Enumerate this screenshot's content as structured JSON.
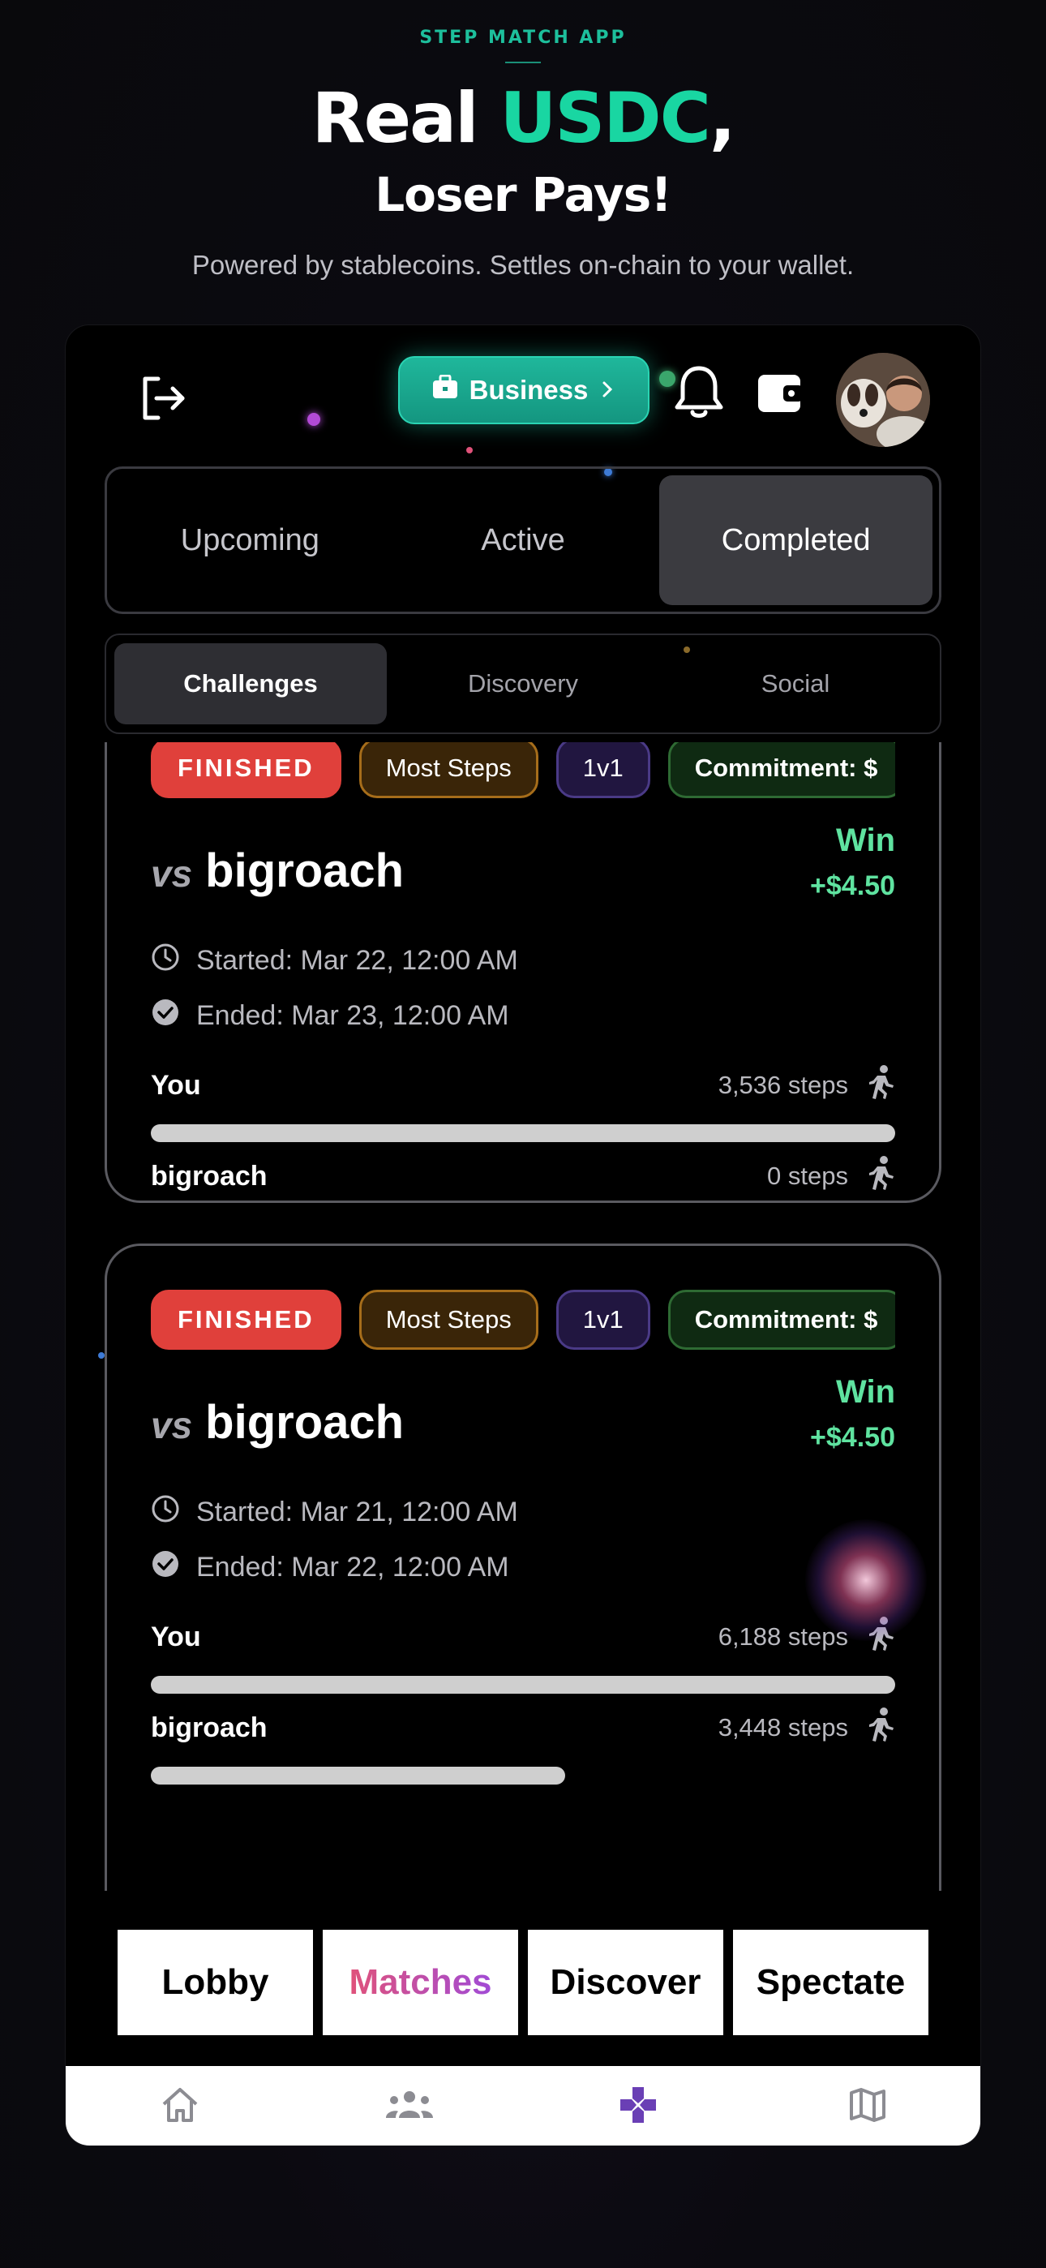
{
  "promo": {
    "kicker": "STEP MATCH APP",
    "headline_part1": "Real ",
    "headline_accent": "USDC",
    "headline_part2": ",",
    "headline_line2": "Loser Pays!",
    "subline": "Powered by stablecoins. Settles on-chain to your wallet."
  },
  "topbar": {
    "logout_icon": "logout-icon",
    "business_label": "Business",
    "business_icon": "briefcase-icon",
    "bell_icon": "bell-icon",
    "wallet_icon": "wallet-icon",
    "avatar": "user-avatar"
  },
  "status_tabs": [
    {
      "label": "Upcoming",
      "active": false
    },
    {
      "label": "Active",
      "active": false
    },
    {
      "label": "Completed",
      "active": true
    }
  ],
  "sub_tabs": [
    {
      "label": "Challenges",
      "active": true
    },
    {
      "label": "Discovery",
      "active": false
    },
    {
      "label": "Social",
      "active": false
    }
  ],
  "challenges": [
    {
      "chips": [
        "FINISHED",
        "Most Steps",
        "1v1",
        "Commitment: $"
      ],
      "vs_prefix": "vs",
      "opponent": "bigroach",
      "result": "Win",
      "amount": "+$4.50",
      "started": "Started: Mar 22, 12:00 AM",
      "ended": "Ended: Mar 23, 12:00 AM",
      "players": [
        {
          "name": "You",
          "steps": "3,536 steps",
          "progress": 1.0
        },
        {
          "name": "bigroach",
          "steps": "0 steps",
          "progress": 0.0
        }
      ]
    },
    {
      "chips": [
        "FINISHED",
        "Most Steps",
        "1v1",
        "Commitment: $"
      ],
      "vs_prefix": "vs",
      "opponent": "bigroach",
      "result": "Win",
      "amount": "+$4.50",
      "started": "Started: Mar 21, 12:00 AM",
      "ended": "Ended: Mar 22, 12:00 AM",
      "players": [
        {
          "name": "You",
          "steps": "6,188 steps",
          "progress": 1.0
        },
        {
          "name": "bigroach",
          "steps": "3,448 steps",
          "progress": 0.557
        }
      ]
    }
  ],
  "segments": [
    {
      "label": "Lobby",
      "active": false
    },
    {
      "label": "Matches",
      "active": true
    },
    {
      "label": "Discover",
      "active": false
    },
    {
      "label": "Spectate",
      "active": false
    }
  ],
  "bottom_nav": [
    {
      "icon": "home-icon",
      "active": false
    },
    {
      "icon": "people-icon",
      "active": false
    },
    {
      "icon": "gamepad-icon",
      "active": true
    },
    {
      "icon": "map-icon",
      "active": false
    }
  ],
  "colors": {
    "accent_teal": "#19d6a2",
    "win_green": "#5fe3a0",
    "finished_red": "#e0403b",
    "nav_active": "#6a3fb5"
  }
}
